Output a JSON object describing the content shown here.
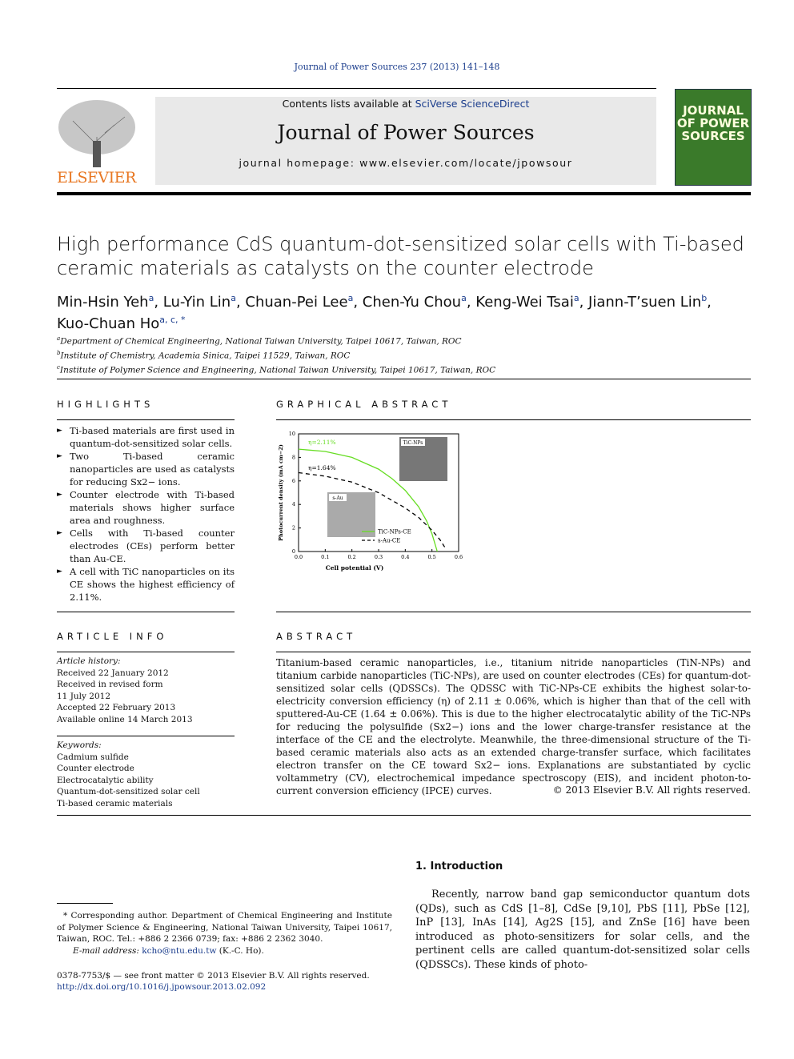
{
  "header": {
    "journal_ref": "Journal of Power Sources 237 (2013) 141–148",
    "contents_prefix": "Contents lists available at ",
    "contents_link": "SciVerse ScienceDirect",
    "journal_title": "Journal of Power Sources",
    "homepage": "journal homepage: www.elsevier.com/locate/jpowsour",
    "publisher": "ELSEVIER",
    "cover_text": "JOURNAL OF POWER SOURCES"
  },
  "article": {
    "title": "High performance CdS quantum-dot-sensitized solar cells with Ti-based ceramic materials as catalysts on the counter electrode",
    "authors": [
      {
        "name": "Min-Hsin Yeh",
        "sup": "a"
      },
      {
        "name": "Lu-Yin Lin",
        "sup": "a"
      },
      {
        "name": "Chuan-Pei Lee",
        "sup": "a"
      },
      {
        "name": "Chen-Yu Chou",
        "sup": "a"
      },
      {
        "name": "Keng-Wei Tsai",
        "sup": "a"
      },
      {
        "name": "Jiann-T’suen Lin",
        "sup": "b"
      },
      {
        "name": "Kuo-Chuan Ho",
        "sup": "a, c, *"
      }
    ],
    "affiliations": [
      {
        "sup": "a",
        "text": "Department of Chemical Engineering, National Taiwan University, Taipei 10617, Taiwan, ROC"
      },
      {
        "sup": "b",
        "text": "Institute of Chemistry, Academia Sinica, Taipei 11529, Taiwan, ROC"
      },
      {
        "sup": "c",
        "text": "Institute of Polymer Science and Engineering, National Taiwan University, Taipei 10617, Taiwan, ROC"
      }
    ]
  },
  "highlights": {
    "heading": "HIGHLIGHTS",
    "items": [
      "Ti-based materials are first used in quantum-dot-sensitized solar cells.",
      "Two Ti-based ceramic nanoparticles are used as catalysts for reducing Sx2− ions.",
      "Counter electrode with Ti-based materials shows higher surface area and roughness.",
      "Cells with Ti-based counter electrodes (CEs) perform better than Au-CE.",
      "A cell with TiC nanoparticles on its CE shows the highest efficiency of 2.11%."
    ]
  },
  "graphical_abstract": {
    "heading": "GRAPHICAL ABSTRACT",
    "inset_tic": "TiC-NPs",
    "inset_au": "s-Au"
  },
  "chart_data": {
    "type": "line",
    "xlabel": "Cell potential (V)",
    "ylabel": "Photocurrent density (mA cm−2)",
    "xlim": [
      0,
      0.6
    ],
    "ylim": [
      0,
      10
    ],
    "xticks": [
      "0.0",
      "0.1",
      "0.2",
      "0.3",
      "0.4",
      "0.5",
      "0.6"
    ],
    "yticks": [
      "0",
      "2",
      "4",
      "6",
      "8",
      "10"
    ],
    "legend_position": "bottom-right",
    "annotations": [
      "η=2.11%",
      "η=1.64%"
    ],
    "series": [
      {
        "name": "TiC-NPs-CE",
        "color": "#66dd22",
        "style": "solid",
        "x": [
          0,
          0.1,
          0.2,
          0.3,
          0.35,
          0.4,
          0.45,
          0.48,
          0.5,
          0.52
        ],
        "y": [
          8.7,
          8.5,
          8.0,
          7.0,
          6.2,
          5.2,
          3.8,
          2.6,
          1.5,
          0
        ]
      },
      {
        "name": "s-Au-CE",
        "color": "#000000",
        "style": "dashed",
        "x": [
          0,
          0.1,
          0.2,
          0.3,
          0.4,
          0.45,
          0.5,
          0.53,
          0.55
        ],
        "y": [
          6.7,
          6.4,
          5.9,
          5.0,
          3.7,
          2.9,
          1.8,
          1.0,
          0.3
        ]
      }
    ]
  },
  "article_info": {
    "heading": "ARTICLE INFO",
    "history_label": "Article history:",
    "history": [
      "Received 22 January 2012",
      "Received in revised form",
      "11 July 2012",
      "Accepted 22 February 2013",
      "Available online 14 March 2013"
    ],
    "keywords_label": "Keywords:",
    "keywords": [
      "Cadmium sulfide",
      "Counter electrode",
      "Electrocatalytic ability",
      "Quantum-dot-sensitized solar cell",
      "Ti-based ceramic materials"
    ]
  },
  "abstract": {
    "heading": "ABSTRACT",
    "text": "Titanium-based ceramic nanoparticles, i.e., titanium nitride nanoparticles (TiN-NPs) and titanium carbide nanoparticles (TiC-NPs), are used on counter electrodes (CEs) for quantum-dot-sensitized solar cells (QDSSCs). The QDSSC with TiC-NPs-CE exhibits the highest solar-to-electricity conversion efficiency (η) of 2.11 ± 0.06%, which is higher than that of the cell with sputtered-Au-CE (1.64 ± 0.06%). This is due to the higher electrocatalytic ability of the TiC-NPs for reducing the polysulfide (Sx2−) ions and the lower charge-transfer resistance at the interface of the CE and the electrolyte. Meanwhile, the three-dimensional structure of the Ti-based ceramic materials also acts as an extended charge-transfer surface, which facilitates electron transfer on the CE toward Sx2− ions. Explanations are substantiated by cyclic voltammetry (CV), electrochemical impedance spectroscopy (EIS), and incident photon-to-current conversion efficiency (IPCE) curves.",
    "copyright": "© 2013 Elsevier B.V. All rights reserved."
  },
  "footnote": {
    "corresponding": "* Corresponding author. Department of Chemical Engineering and Institute of Polymer Science & Engineering, National Taiwan University, Taipei 10617, Taiwan, ROC. Tel.: +886 2 2366 0739; fax: +886 2 2362 3040.",
    "email_label": "E-mail address: ",
    "email": "kcho@ntu.edu.tw",
    "email_suffix": " (K.-C. Ho).",
    "issn": "0378-7753/$ — see front matter © 2013 Elsevier B.V. All rights reserved.",
    "doi": "http://dx.doi.org/10.1016/j.jpowsour.2013.02.092"
  },
  "introduction": {
    "heading": "1.  Introduction",
    "text": "Recently, narrow band gap semiconductor quantum dots (QDs), such as CdS [1–8], CdSe [9,10], PbS [11], PbSe [12], InP [13], InAs [14], Ag2S [15], and ZnSe [16] have been introduced as photo-sensitizers for solar cells, and the pertinent cells are called quantum-dot-sensitized solar cells (QDSSCs). These kinds of photo-"
  }
}
